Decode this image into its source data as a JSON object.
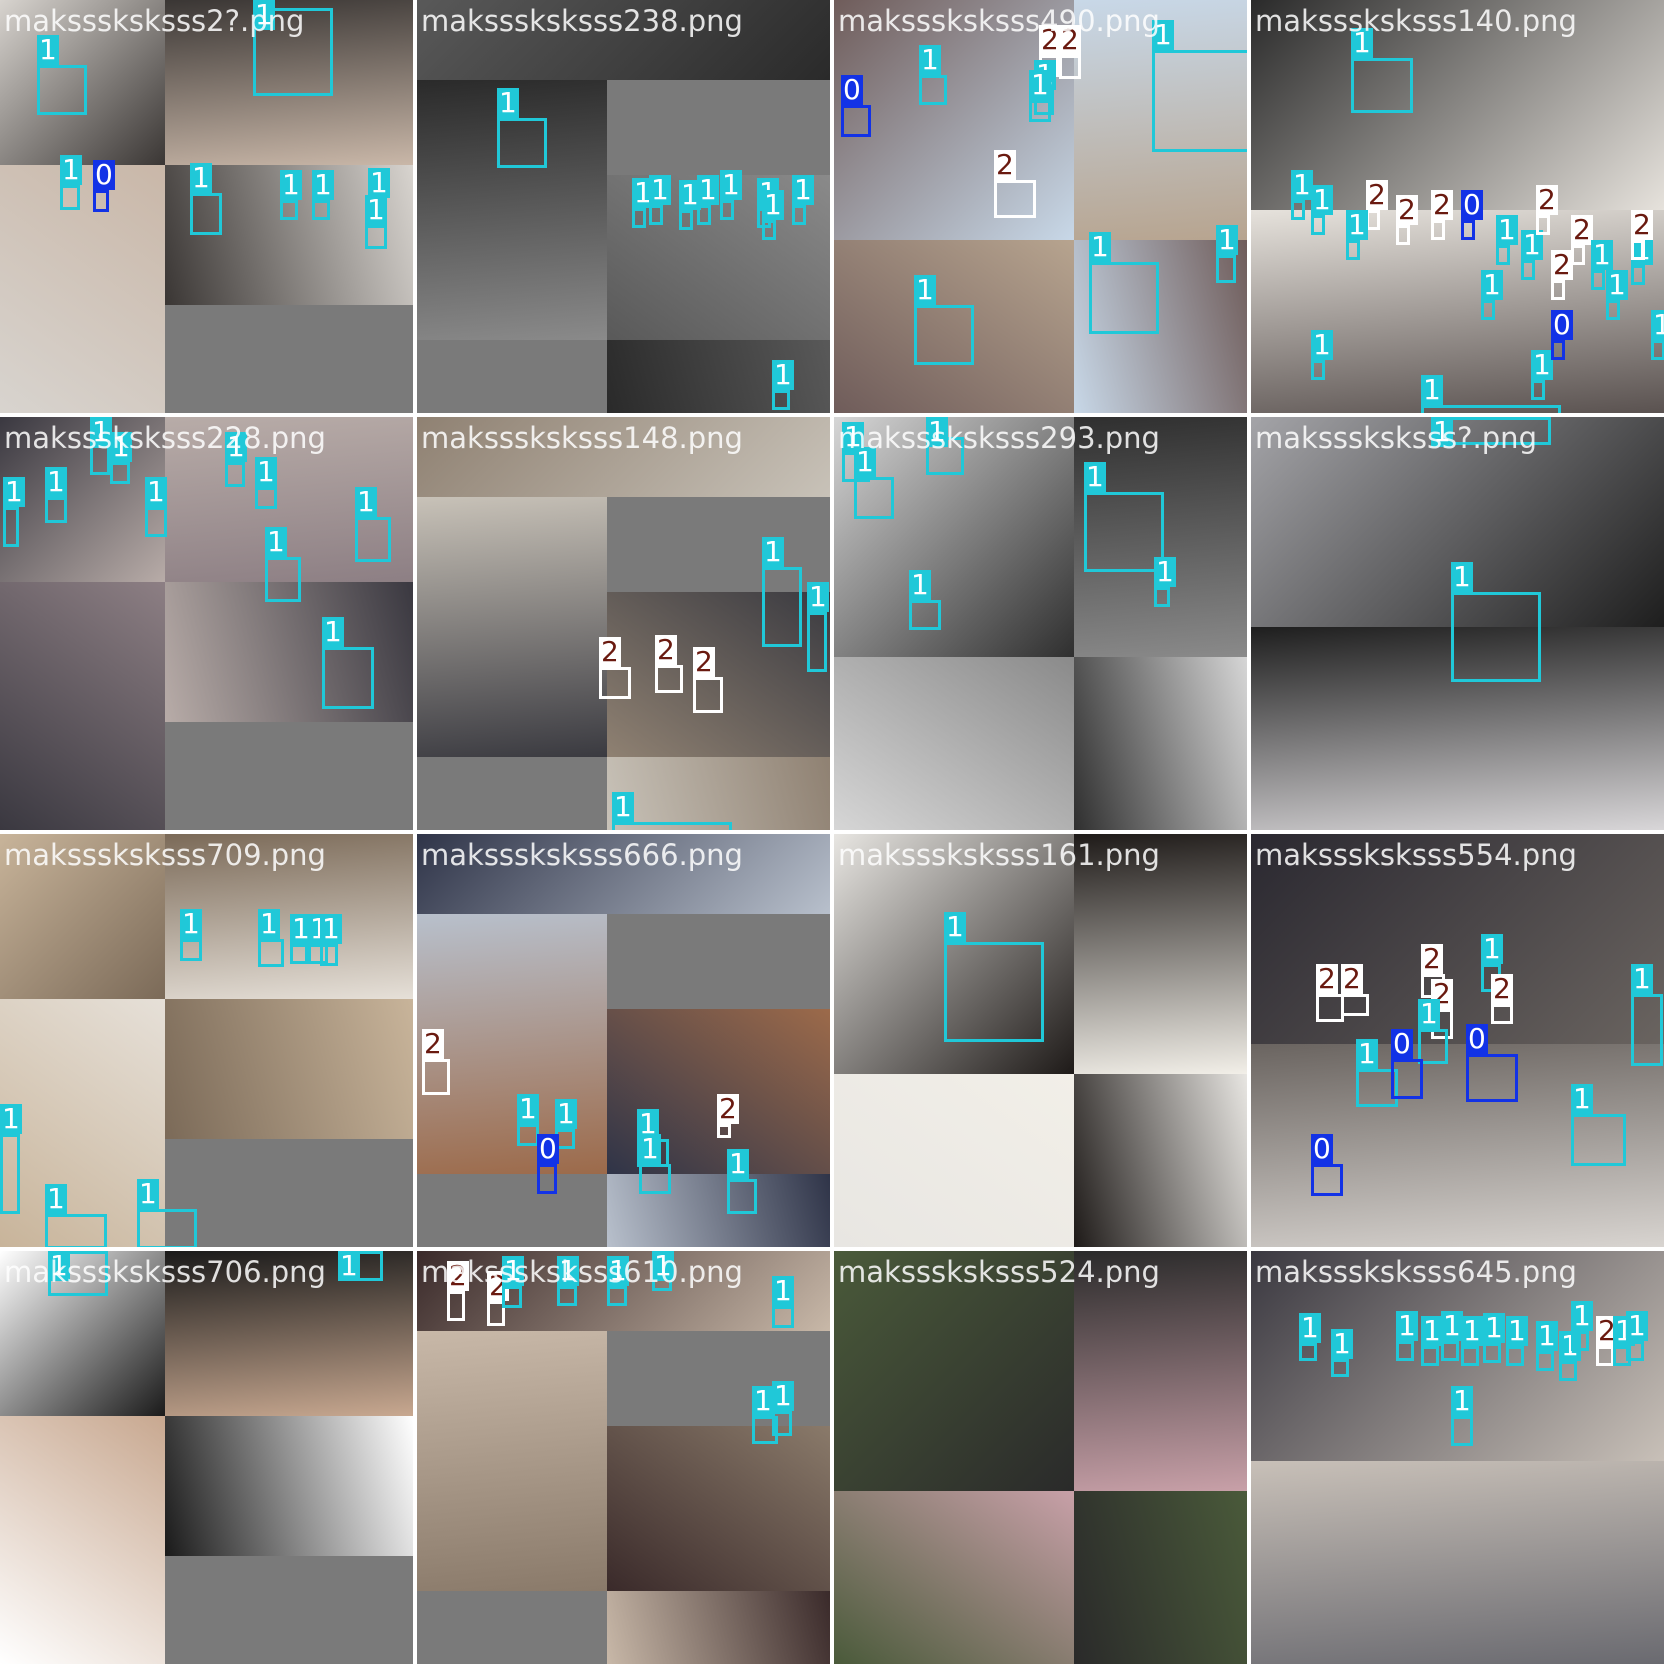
{
  "mosaic": {
    "tiles": [
      {
        "filename": "maksssksksss2?.png",
        "palette": [
          "#d8d4cf",
          "#3a3634",
          "#c9b7a8"
        ],
        "boxes": [
          {
            "cls": "1"
          },
          {
            "cls": "1"
          },
          {
            "cls": "1"
          },
          {
            "cls": "0"
          },
          {
            "cls": "1"
          },
          {
            "cls": "1"
          },
          {
            "cls": "1"
          },
          {
            "cls": "1"
          },
          {
            "cls": "1"
          }
        ]
      },
      {
        "filename": "maksssksksss238.png",
        "palette": [
          "#595959",
          "#2a2a2a",
          "#8a8a8a"
        ],
        "boxes": [
          {
            "cls": "1"
          },
          {
            "cls": "1"
          },
          {
            "cls": "1"
          },
          {
            "cls": "1"
          },
          {
            "cls": "1"
          },
          {
            "cls": "1"
          },
          {
            "cls": "1"
          },
          {
            "cls": "1"
          },
          {
            "cls": "1"
          },
          {
            "cls": "1"
          }
        ]
      },
      {
        "filename": "maksssksksss490.png",
        "palette": [
          "#6f5c5a",
          "#c8d8e8",
          "#b7a48f"
        ],
        "boxes": [
          {
            "cls": "2"
          },
          {
            "cls": "2"
          },
          {
            "cls": "1"
          },
          {
            "cls": "0"
          },
          {
            "cls": "1"
          },
          {
            "cls": "1"
          },
          {
            "cls": "1"
          },
          {
            "cls": "2"
          },
          {
            "cls": "1"
          },
          {
            "cls": "1"
          },
          {
            "cls": "1"
          }
        ]
      },
      {
        "filename": "maksssksksss140.png",
        "palette": [
          "#2a2a2a",
          "#e6e2dc",
          "#5a5250"
        ],
        "boxes": [
          {
            "cls": "1"
          },
          {
            "cls": "1"
          },
          {
            "cls": "1"
          },
          {
            "cls": "2"
          },
          {
            "cls": "1"
          },
          {
            "cls": "2"
          },
          {
            "cls": "2"
          },
          {
            "cls": "0"
          },
          {
            "cls": "1"
          },
          {
            "cls": "1"
          },
          {
            "cls": "2"
          },
          {
            "cls": "2"
          },
          {
            "cls": "2"
          },
          {
            "cls": "1"
          },
          {
            "cls": "1"
          },
          {
            "cls": "1"
          },
          {
            "cls": "2"
          },
          {
            "cls": "1"
          },
          {
            "cls": "1"
          },
          {
            "cls": "0"
          },
          {
            "cls": "1"
          },
          {
            "cls": "1"
          },
          {
            "cls": "1"
          }
        ]
      },
      {
        "filename": "maksssksksss228.png",
        "palette": [
          "#3a3840",
          "#b8aca8",
          "#8d7f84"
        ],
        "boxes": [
          {
            "cls": "1"
          },
          {
            "cls": "1"
          },
          {
            "cls": "1"
          },
          {
            "cls": "1"
          },
          {
            "cls": "1"
          },
          {
            "cls": "1"
          },
          {
            "cls": "1"
          },
          {
            "cls": "1"
          },
          {
            "cls": "1"
          },
          {
            "cls": "1"
          }
        ]
      },
      {
        "filename": "maksssksksss148.png",
        "palette": [
          "#8f8172",
          "#c8c2b8",
          "#3a3a40"
        ],
        "boxes": [
          {
            "cls": "2"
          },
          {
            "cls": "2"
          },
          {
            "cls": "2"
          },
          {
            "cls": "1"
          },
          {
            "cls": "1"
          },
          {
            "cls": "1"
          }
        ]
      },
      {
        "filename": "maksssksksss293.png",
        "palette": [
          "#d6d6d6",
          "#2f2f2f",
          "#8a8a8a"
        ],
        "boxes": [
          {
            "cls": "1"
          },
          {
            "cls": "1"
          },
          {
            "cls": "1"
          },
          {
            "cls": "1"
          },
          {
            "cls": "1"
          },
          {
            "cls": "1"
          }
        ]
      },
      {
        "filename": "maksssksksss?.png",
        "palette": [
          "#a4a4a8",
          "#1e1e1e",
          "#d8d6d8"
        ],
        "boxes": [
          {
            "cls": "1"
          },
          {
            "cls": "1"
          }
        ]
      },
      {
        "filename": "maksssksksss709.png",
        "palette": [
          "#c8b49a",
          "#7b6a58",
          "#e6e0d8"
        ],
        "boxes": [
          {
            "cls": "1"
          },
          {
            "cls": "1"
          },
          {
            "cls": "1"
          },
          {
            "cls": "1"
          },
          {
            "cls": "1"
          },
          {
            "cls": "1"
          },
          {
            "cls": "1"
          },
          {
            "cls": "1"
          }
        ]
      },
      {
        "filename": "maksssksksss666.png",
        "palette": [
          "#2f3448",
          "#b8c0cc",
          "#9c6a4a"
        ],
        "boxes": [
          {
            "cls": "2"
          },
          {
            "cls": "1"
          },
          {
            "cls": "1"
          },
          {
            "cls": "0"
          },
          {
            "cls": "1"
          },
          {
            "cls": "1"
          },
          {
            "cls": "2"
          },
          {
            "cls": "1"
          }
        ]
      },
      {
        "filename": "maksssksksss161.png",
        "palette": [
          "#e8e6e2",
          "#1e1a18",
          "#f2efe8"
        ],
        "boxes": [
          {
            "cls": "1"
          }
        ]
      },
      {
        "filename": "maksssksksss554.png",
        "palette": [
          "#2a2830",
          "#6a6460",
          "#d8d4d0"
        ],
        "boxes": [
          {
            "cls": "2"
          },
          {
            "cls": "2"
          },
          {
            "cls": "2"
          },
          {
            "cls": "2"
          },
          {
            "cls": "1"
          },
          {
            "cls": "2"
          },
          {
            "cls": "1"
          },
          {
            "cls": "1"
          },
          {
            "cls": "0"
          },
          {
            "cls": "0"
          },
          {
            "cls": "1"
          },
          {
            "cls": "0"
          },
          {
            "cls": "1"
          }
        ]
      },
      {
        "filename": "maksssksksss706.png",
        "palette": [
          "#ffffff",
          "#1a1a1a",
          "#c8a890"
        ],
        "boxes": [
          {
            "cls": "1"
          },
          {
            "cls": "1"
          }
        ]
      },
      {
        "filename": "maksssksksss610.png",
        "palette": [
          "#3a2a2a",
          "#c8b8a8",
          "#8a7a6a"
        ],
        "boxes": [
          {
            "cls": "2"
          },
          {
            "cls": "2"
          },
          {
            "cls": "1"
          },
          {
            "cls": "1"
          },
          {
            "cls": "1"
          },
          {
            "cls": "1"
          },
          {
            "cls": "1"
          },
          {
            "cls": "1"
          },
          {
            "cls": "1"
          }
        ]
      },
      {
        "filename": "maksssksksss524.png",
        "palette": [
          "#4a5a3a",
          "#2a2a2a",
          "#c8a0a8"
        ],
        "boxes": []
      },
      {
        "filename": "maksssksksss645.png",
        "palette": [
          "#3a3840",
          "#c8c0b8",
          "#6a6a70"
        ],
        "boxes": [
          {
            "cls": "1"
          },
          {
            "cls": "1"
          },
          {
            "cls": "1"
          },
          {
            "cls": "1"
          },
          {
            "cls": "1"
          },
          {
            "cls": "1"
          },
          {
            "cls": "1"
          },
          {
            "cls": "1"
          },
          {
            "cls": "1"
          },
          {
            "cls": "1"
          },
          {
            "cls": "1"
          },
          {
            "cls": "2"
          },
          {
            "cls": "1"
          },
          {
            "cls": "1"
          },
          {
            "cls": "1"
          }
        ]
      }
    ]
  }
}
